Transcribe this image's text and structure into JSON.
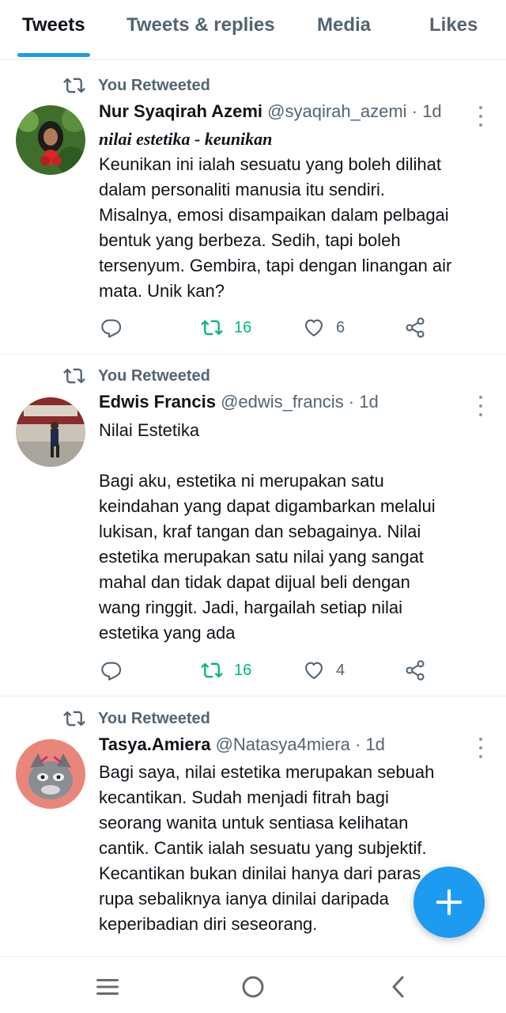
{
  "tabs": [
    {
      "label": "Tweets",
      "active": true
    },
    {
      "label": "Tweets & replies",
      "active": false
    },
    {
      "label": "Media",
      "active": false
    },
    {
      "label": "Likes",
      "active": false
    }
  ],
  "tweets": [
    {
      "retweet_label": "You Retweeted",
      "name": "Nur Syaqirah Azemi",
      "handle": "@syaqirah_azemi · 1d",
      "subtitle": "nilai estetika - keunikan",
      "lines": [
        "Keunikan ini ialah sesuatu yang boleh dilihat",
        "dalam personaliti manusia itu sendiri.",
        "Misalnya, emosi disampaikan dalam pelbagai",
        "bentuk yang berbeza. Sedih, tapi boleh",
        "tersenyum. Gembira, tapi dengan linangan air",
        "mata. Unik kan?"
      ],
      "retweets": "16",
      "likes": "6"
    },
    {
      "retweet_label": "You Retweeted",
      "name": "Edwis Francis",
      "handle": "@edwis_francis · 1d",
      "title_line": "Nilai Estetika",
      "lines": [
        "Bagi aku, estetika ni merupakan satu",
        "keindahan yang dapat digambarkan melalui",
        "lukisan, kraf tangan dan sebagainya. Nilai",
        "estetika merupakan satu nilai yang sangat",
        "mahal dan tidak dapat dijual beli dengan",
        "wang ringgit. Jadi, hargailah setiap nilai",
        "estetika yang ada"
      ],
      "retweets": "16",
      "likes": "4"
    },
    {
      "retweet_label": "You Retweeted",
      "name": "Tasya.Amiera",
      "handle": "@Natasya4miera · 1d",
      "lines": [
        "Bagi saya, nilai estetika merupakan sebuah",
        "kecantikan. Sudah menjadi fitrah bagi",
        "seorang wanita untuk sentiasa kelihatan",
        "cantik. Cantik ialah sesuatu yang subjektif.",
        "Kecantikan bukan dinilai hanya dari paras",
        "rupa sebaliknya ianya dinilai daripada",
        "keperibadian diri seseorang."
      ]
    }
  ],
  "colors": {
    "accent": "#1d9bf0",
    "retweet_green": "#00ba7c",
    "muted": "#536471"
  }
}
